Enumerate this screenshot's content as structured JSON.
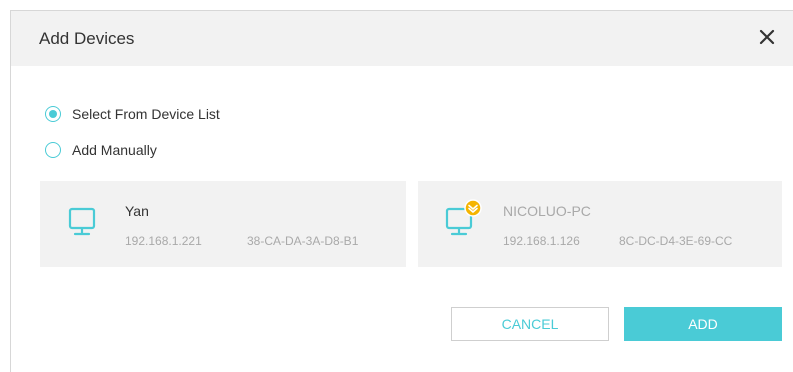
{
  "dialog": {
    "title": "Add Devices",
    "close_icon": "close-icon"
  },
  "options": [
    {
      "label": "Select From Device List",
      "checked": true
    },
    {
      "label": "Add Manually",
      "checked": false
    }
  ],
  "devices": [
    {
      "name": "Yan",
      "ip": "192.168.1.221",
      "mac": "38-CA-DA-3A-D8-B1",
      "icon": "monitor-icon",
      "online": true
    },
    {
      "name": "NICOLUO-PC",
      "ip": "192.168.1.126",
      "mac": "8C-DC-D4-3E-69-CC",
      "icon": "monitor-icon",
      "badge_icon": "blocked-status-icon",
      "online": false
    }
  ],
  "buttons": {
    "cancel": "CANCEL",
    "add": "ADD"
  },
  "colors": {
    "accent": "#4acbd6",
    "badge": "#f5b400",
    "card_bg": "#f2f2f2"
  }
}
